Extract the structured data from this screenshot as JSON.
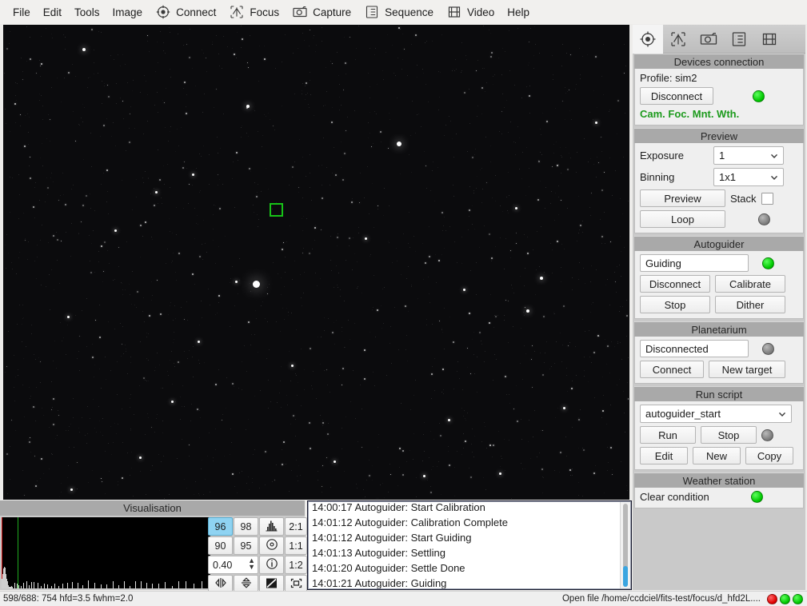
{
  "menubar": {
    "items": [
      {
        "label": "File",
        "icon": null
      },
      {
        "label": "Edit",
        "icon": null
      },
      {
        "label": "Tools",
        "icon": null
      },
      {
        "label": "Image",
        "icon": null
      },
      {
        "label": "Connect",
        "icon": "target-icon"
      },
      {
        "label": "Focus",
        "icon": "focus-crosshair-icon"
      },
      {
        "label": "Capture",
        "icon": "camera-icon"
      },
      {
        "label": "Sequence",
        "icon": "list-icon"
      },
      {
        "label": "Video",
        "icon": "film-icon"
      },
      {
        "label": "Help",
        "icon": null
      }
    ]
  },
  "sidebar": {
    "tabs": [
      {
        "name": "tab-connection",
        "icon": "target-icon",
        "active": true
      },
      {
        "name": "tab-focus",
        "icon": "focus-crosshair-icon",
        "active": false
      },
      {
        "name": "tab-capture",
        "icon": "camera-icon",
        "active": false
      },
      {
        "name": "tab-sequence",
        "icon": "list-icon",
        "active": false
      },
      {
        "name": "tab-video",
        "icon": "film-icon",
        "active": false
      }
    ],
    "devices": {
      "title": "Devices connection",
      "profile": "Profile: sim2",
      "disconnect_label": "Disconnect",
      "status_led": "green",
      "devices_line": "Cam. Foc. Mnt. Wth."
    },
    "preview": {
      "title": "Preview",
      "exposure_label": "Exposure",
      "exposure_value": "1",
      "binning_label": "Binning",
      "binning_value": "1x1",
      "preview_label": "Preview",
      "stack_label": "Stack",
      "stack_checked": false,
      "loop_label": "Loop",
      "loop_led": "gray"
    },
    "autoguider": {
      "title": "Autoguider",
      "state": "Guiding",
      "state_led": "green",
      "disconnect_label": "Disconnect",
      "calibrate_label": "Calibrate",
      "stop_label": "Stop",
      "dither_label": "Dither"
    },
    "planetarium": {
      "title": "Planetarium",
      "state": "Disconnected",
      "state_led": "gray",
      "connect_label": "Connect",
      "new_target_label": "New target"
    },
    "runscript": {
      "title": "Run script",
      "script_value": "autoguider_start",
      "run_label": "Run",
      "stop_label": "Stop",
      "run_led": "gray",
      "edit_label": "Edit",
      "new_label": "New",
      "copy_label": "Copy"
    },
    "weather": {
      "title": "Weather station",
      "condition": "Clear condition",
      "condition_led": "green"
    }
  },
  "visualisation": {
    "title": "Visualisation",
    "buttons": {
      "b96": "96",
      "b98": "98",
      "b90": "90",
      "b95": "95",
      "ratio_2_1": "2:1",
      "ratio_1_1": "1:1",
      "ratio_1_2": "1:2",
      "spin_value": "0.40",
      "histogram_icon": "histogram-icon",
      "circle_icon": "target-circle-icon",
      "info_icon": "info-icon",
      "flip_horizontal_icon": "flip-horizontal-icon",
      "flip_vertical_icon": "flip-vertical-icon",
      "invert_icon": "invert-contrast-icon",
      "fit_icon": "fit-to-window-icon"
    },
    "selected_button": "96"
  },
  "log": {
    "lines": [
      "14:00:17 Autoguider: Start Calibration",
      "14:01:12 Autoguider: Calibration Complete",
      "14:01:12 Autoguider: Start Guiding",
      "14:01:13 Autoguider: Settling",
      "14:01:20 Autoguider: Settle Done",
      "14:01:21 Autoguider: Guiding"
    ]
  },
  "statusbar": {
    "left": "598/688: 754 hfd=3.5 fwhm=2.0",
    "right": "Open file /home/ccdciel/fits-test/focus/d_hfd2L....",
    "leds": [
      "red",
      "green",
      "green"
    ]
  },
  "colors": {
    "led_green": "#00c800",
    "led_red": "#e00000",
    "led_gray": "#7d7d7d",
    "selection_box": "#17c217",
    "accent_selected": "#8fd3f2",
    "group_header": "#a9a9a9",
    "scroll_thumb": "#3aa5e0"
  }
}
